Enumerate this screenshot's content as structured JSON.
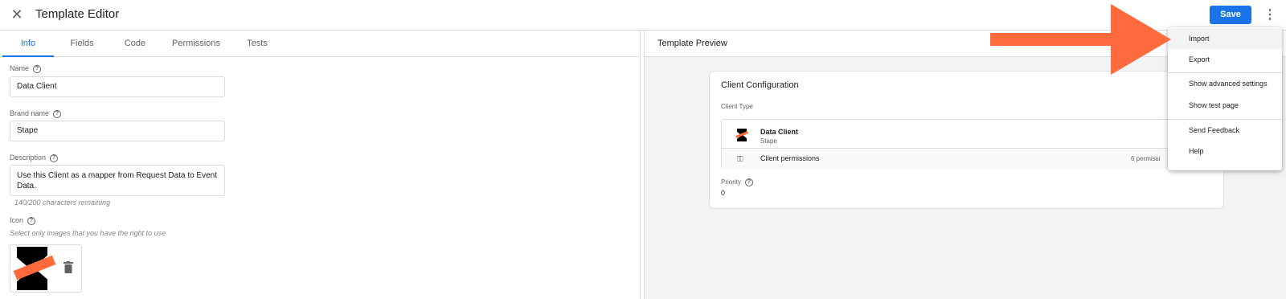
{
  "header": {
    "close_icon": "close-icon",
    "title": "Template Editor",
    "save_label": "Save",
    "more_icon": "more-vert-icon",
    "save_color": "#1a73e8"
  },
  "tabs": [
    {
      "label": "Info",
      "active": true
    },
    {
      "label": "Fields"
    },
    {
      "label": "Code"
    },
    {
      "label": "Permissions"
    },
    {
      "label": "Tests"
    }
  ],
  "info": {
    "name_label": "Name",
    "name_value": "Data Client",
    "brand_label": "Brand name",
    "brand_value": "Stape",
    "description_label": "Description",
    "description_value": "Use this Client as a mapper from Request Data to Event Data.",
    "description_hint": "140/200 characters remaining",
    "icon_label": "Icon",
    "icon_hint": "Select only images that you have the right to use"
  },
  "preview": {
    "title": "Template Preview",
    "card_title": "Client Configuration",
    "client_type_label": "Client Type",
    "client_name": "Data Client",
    "client_brand": "Stape",
    "permissions_label": "Client permissions",
    "permissions_count": "6 permissi",
    "priority_label": "Priority",
    "priority_value": "0"
  },
  "menu": {
    "items": [
      {
        "label": "Import",
        "highlighted": true
      },
      {
        "label": "Export"
      },
      {
        "label": "Show advanced settings"
      },
      {
        "label": "Show test page"
      },
      {
        "label": "Send Feedback"
      },
      {
        "label": "Help"
      }
    ]
  },
  "colors": {
    "accent": "#1a73e8",
    "annotation_arrow": "#ff6b3d"
  }
}
